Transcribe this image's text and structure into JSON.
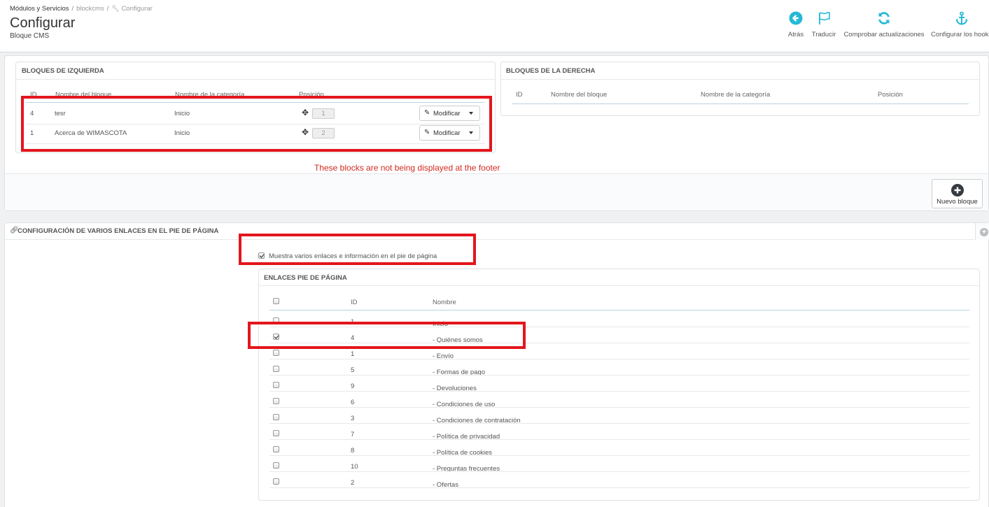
{
  "breadcrumb": {
    "item1": "Módulos y Servicios",
    "item2": "blockcms",
    "current": "Configurar",
    "separator": "/"
  },
  "header": {
    "title": "Configurar",
    "subtitle": "Bloque CMS"
  },
  "toolbar": [
    {
      "label": "Atrás",
      "icon": "arrow-left-circle-icon"
    },
    {
      "label": "Traducir",
      "icon": "flag-icon"
    },
    {
      "label": "Comprobar actualizaciones",
      "icon": "refresh-icon"
    },
    {
      "label": "Configurar los hooks",
      "icon": "anchor-icon"
    }
  ],
  "left_blocks": {
    "title": "BLOQUES DE IZQUIERDA",
    "columns": {
      "id": "ID",
      "name": "Nombre del bloque",
      "category": "Nombre de la categoría",
      "position": "Posición"
    },
    "rows": [
      {
        "id": "4",
        "name": "tesr",
        "category": "Inicio",
        "position": "1",
        "action": "Modificar"
      },
      {
        "id": "1",
        "name": "Acerca de WIMASCOTA",
        "category": "Inicio",
        "position": "2",
        "action": "Modificar"
      }
    ]
  },
  "right_blocks": {
    "title": "BLOQUES DE LA DERECHA",
    "columns": {
      "id": "ID",
      "name": "Nombre del bloque",
      "category": "Nombre de la categoría",
      "position": "Posición"
    }
  },
  "annotation": "These blocks are not being displayed at the footer",
  "new_block_label": "Nuevo bloque",
  "footer_config": {
    "title": "CONFIGURACIÓN DE VARIOS ENLACES EN EL PIE DE PÁGINA",
    "show_links_label": "Muestra varios enlaces e información en el pie de página",
    "show_links_checked": true,
    "links_panel_title": "ENLACES PIE DE PÁGINA",
    "col_id": "ID",
    "col_name": "Nombre",
    "rows": [
      {
        "id": "1",
        "name": "Inicio",
        "checked": false
      },
      {
        "id": "4",
        "name": "- Quiénes somos",
        "checked": true
      },
      {
        "id": "1",
        "name": "- Envío",
        "checked": false
      },
      {
        "id": "5",
        "name": "- Formas de pago",
        "checked": false
      },
      {
        "id": "9",
        "name": "- Devoluciones",
        "checked": false
      },
      {
        "id": "6",
        "name": "- Condiciones de uso",
        "checked": false
      },
      {
        "id": "3",
        "name": "- Condiciones de contratación",
        "checked": false
      },
      {
        "id": "7",
        "name": "- Política de privacidad",
        "checked": false
      },
      {
        "id": "8",
        "name": "- Política de cookies",
        "checked": false
      },
      {
        "id": "10",
        "name": "- Preguntas frecuentes",
        "checked": false
      },
      {
        "id": "2",
        "name": "- Ofertas",
        "checked": false
      }
    ]
  },
  "colors": {
    "accent": "#25b9d7",
    "annotation_red": "#e3161d",
    "panel_bg": "#ffffff",
    "page_bg": "#eff1f2"
  }
}
